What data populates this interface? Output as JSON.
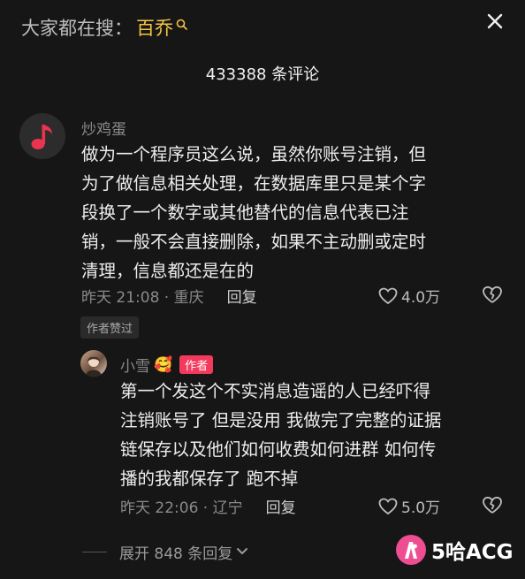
{
  "header": {
    "search_prefix": "大家都在搜：",
    "search_keyword": "百乔",
    "search_icon": "search-icon",
    "close_icon": "close-icon",
    "comment_count": "433388 条评论"
  },
  "comment": {
    "username": "炒鸡蛋",
    "avatar_icon": "music-note-icon",
    "lines": [
      "做为一个程序员这么说，虽然你账号注销，但",
      "为了做信息相关处理，在数据库里只是某个字",
      "段换了一个数字或其他替代的信息代表已注",
      "销，一般不会直接删除，如果不主动删或定时",
      "清理，信息都还是在的"
    ],
    "time_location": "昨天 21:08 · 重庆",
    "reply_label": "回复",
    "like_count": "4.0万",
    "author_liked_label": "作者赞过"
  },
  "reply": {
    "username": "小雪",
    "emoji": "🥰",
    "author_badge": "作者",
    "lines": [
      "第一个发这个不实消息造谣的人已经吓得",
      "注销账号了 但是没用 我做完了完整的证据",
      "链保存以及他们如何收费如何进群 如何传",
      "播的我都保存了 跑不掉"
    ],
    "time_location": "昨天 22:06 · 辽宁",
    "reply_label": "回复",
    "like_count": "5.0万"
  },
  "expand_label": "展开 848 条回复",
  "watermark": {
    "text": "5哈ACG"
  },
  "colors": {
    "background": "#161616",
    "keyword": "#f5c542",
    "author_badge": "#f43a5c",
    "watermark": "#ee4d92"
  }
}
